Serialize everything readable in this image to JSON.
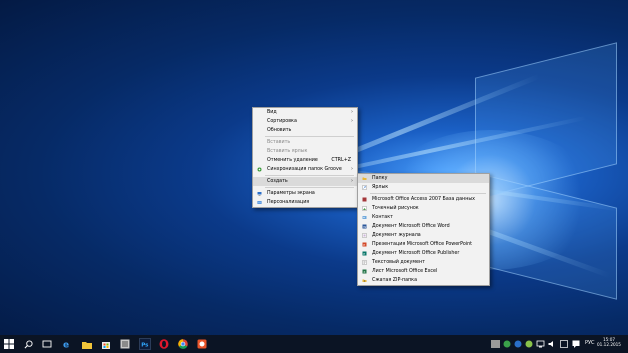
{
  "context_menu": {
    "items": [
      {
        "label": "Вид",
        "submenu": true
      },
      {
        "label": "Сортировка",
        "submenu": true
      },
      {
        "label": "Обновить"
      }
    ],
    "clipboard": [
      {
        "label": "Вставить",
        "disabled": true
      },
      {
        "label": "Вставить ярлык",
        "disabled": true
      },
      {
        "label": "Отменить удаление",
        "shortcut": "CTRL+Z"
      },
      {
        "label": "Синхронизация папок Groove",
        "submenu": true
      }
    ],
    "create": {
      "label": "Создать",
      "submenu": true
    },
    "settings": [
      {
        "label": "Параметры экрана"
      },
      {
        "label": "Персонализация"
      }
    ]
  },
  "submenu": {
    "top": [
      {
        "label": "Папку",
        "icon": "folder-icon"
      },
      {
        "label": "Ярлык",
        "icon": "shortcut-icon"
      }
    ],
    "items": [
      {
        "label": "Microsoft Office Access 2007 База данных",
        "icon": "access-icon"
      },
      {
        "label": "Точечный рисунок",
        "icon": "bitmap-icon"
      },
      {
        "label": "Контакт",
        "icon": "contact-icon"
      },
      {
        "label": "Документ Microsoft Office Word",
        "icon": "word-icon"
      },
      {
        "label": "Документ журнала",
        "icon": "journal-icon"
      },
      {
        "label": "Презентация Microsoft Office PowerPoint",
        "icon": "powerpoint-icon"
      },
      {
        "label": "Документ Microsoft Office Publisher",
        "icon": "publisher-icon"
      },
      {
        "label": "Текстовый документ",
        "icon": "text-icon"
      },
      {
        "label": "Лист Microsoft Office Excel",
        "icon": "excel-icon"
      },
      {
        "label": "Сжатая ZIP-папка",
        "icon": "zip-folder-icon"
      }
    ]
  },
  "taskbar": {
    "lang": "РУС",
    "time": "15:07",
    "date": "01.12.2015"
  },
  "colors": {
    "menu_bg": "#f2f2f2",
    "highlight": "#dadada",
    "taskbar": "#0b1424"
  }
}
